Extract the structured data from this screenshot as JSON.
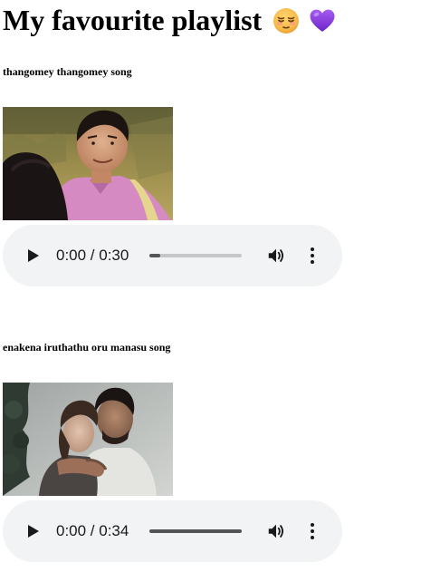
{
  "header": {
    "title": "My favourite playlist",
    "emojis": [
      "relieved-face-emoji",
      "purple-heart-emoji"
    ]
  },
  "songs": [
    {
      "title": "thangomey thangomey song",
      "player": {
        "time": "0:00 / 0:30",
        "progress": 0.0,
        "buffered": 0.12
      }
    },
    {
      "title": "enakena iruthathu oru manasu song",
      "player": {
        "time": "0:00 / 0:34",
        "progress": 0.0,
        "buffered": 1.0
      }
    }
  ],
  "colors": {
    "player_bg": "#f1f3f4",
    "track": "#c4c6c7",
    "track_fill": "#555555",
    "heart": "#8a3ce0",
    "face": "#f6b94a"
  }
}
